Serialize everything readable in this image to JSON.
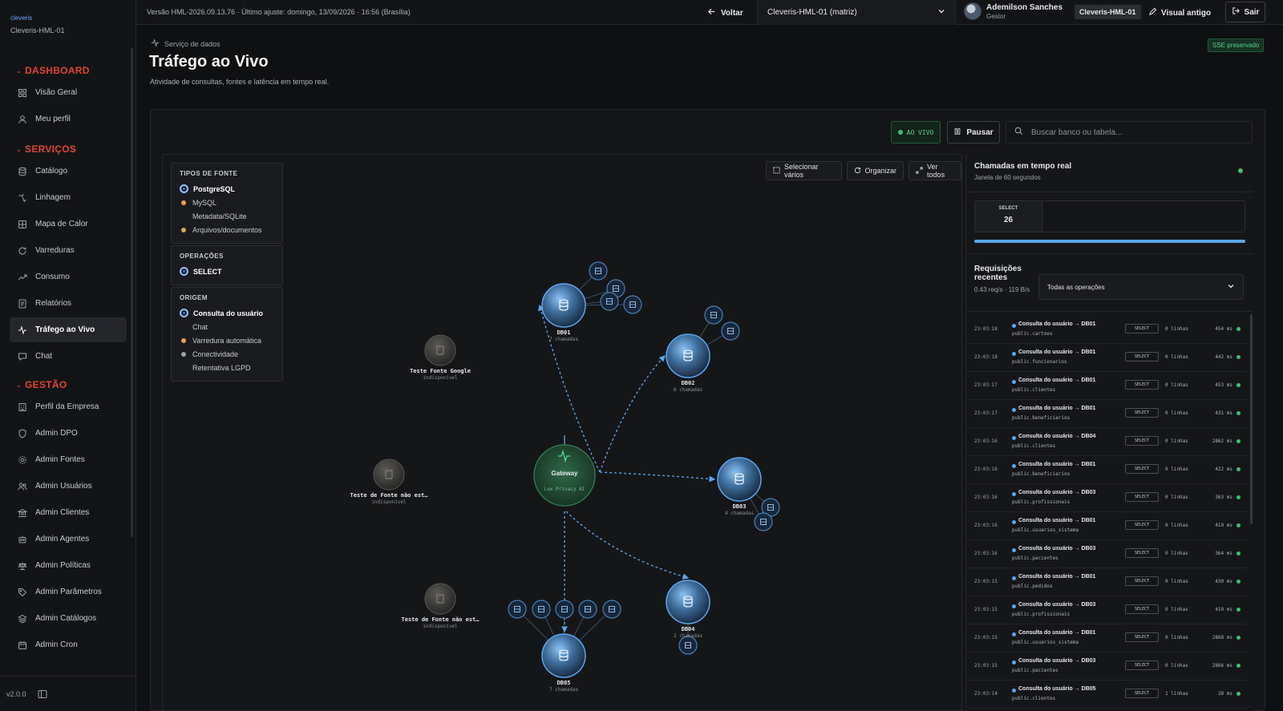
{
  "brand": {
    "logo": "cleveris",
    "env": "Cleveris-HML-01"
  },
  "sidebar": {
    "sections": [
      {
        "title": "DASHBOARD",
        "items": [
          {
            "label": "Visão Geral",
            "icon": "grid-icon"
          },
          {
            "label": "Meu perfil",
            "icon": "user-icon"
          }
        ]
      },
      {
        "title": "SERVIÇOS",
        "items": [
          {
            "label": "Catálogo",
            "icon": "database-icon"
          },
          {
            "label": "Linhagem",
            "icon": "lineage-icon"
          },
          {
            "label": "Mapa de Calor",
            "icon": "heatmap-icon"
          },
          {
            "label": "Varreduras",
            "icon": "refresh-icon"
          },
          {
            "label": "Consumo",
            "icon": "trend-icon"
          },
          {
            "label": "Relatórios",
            "icon": "report-icon"
          },
          {
            "label": "Tráfego ao Vivo",
            "icon": "activity-icon",
            "active": true
          },
          {
            "label": "Chat",
            "icon": "chat-icon"
          }
        ]
      },
      {
        "title": "GESTÃO",
        "items": [
          {
            "label": "Perfil da Empresa",
            "icon": "building-icon"
          },
          {
            "label": "Admin DPO",
            "icon": "shield-icon"
          },
          {
            "label": "Admin Fontes",
            "icon": "gear-icon"
          },
          {
            "label": "Admin Usuários",
            "icon": "users-icon"
          },
          {
            "label": "Admin Clientes",
            "icon": "bank-icon"
          },
          {
            "label": "Admin Agentes",
            "icon": "robot-icon"
          },
          {
            "label": "Admin Políticas",
            "icon": "scale-icon"
          },
          {
            "label": "Admin Parâmetros",
            "icon": "tag-icon"
          },
          {
            "label": "Admin Catálogos",
            "icon": "layers-icon"
          },
          {
            "label": "Admin Cron",
            "icon": "calendar-icon"
          }
        ]
      }
    ],
    "version": "v2.0.0"
  },
  "topbar": {
    "info": "Versão HML-2026.09.13.76 · Último ajuste: domingo, 13/09/2026 · 16:56 (Brasília)",
    "back_label": "Voltar",
    "env_select": "Cleveris-HML-01 (matriz)",
    "user_name": "Ademilson Sanches",
    "user_role": "Gestor",
    "env_badge": "Cleveris-HML-01",
    "visual_label": "Visual antigo",
    "exit_label": "Sair"
  },
  "header": {
    "crumb": "Serviço de dados",
    "title": "Tráfego ao Vivo",
    "subtitle": "Atividade de consultas, fontes e latência em tempo real.",
    "sse_badge": "SSE preservado"
  },
  "controls": {
    "live_label": "AO VIVO",
    "pause_label": "Pausar",
    "search_placeholder": "Buscar banco ou tabela..."
  },
  "graph_toolbar": {
    "select_label": "Selecionar vários",
    "organize_label": "Organizar",
    "view_all_label": "Ver todos"
  },
  "filters": {
    "source_types": {
      "title": "TIPOS DE FONTE",
      "items": [
        {
          "label": "PostgreSQL",
          "selected": true,
          "color": ""
        },
        {
          "label": "MySQL",
          "selected": false,
          "color": "#e8a24a"
        },
        {
          "label": "Metadata/SQLite",
          "selected": false,
          "color": ""
        },
        {
          "label": "Arquivos/documentos",
          "selected": false,
          "color": "#e8a24a"
        }
      ]
    },
    "operations": {
      "title": "OPERAÇÕES",
      "items": [
        {
          "label": "SELECT",
          "selected": true,
          "color": ""
        }
      ]
    },
    "origin": {
      "title": "ORIGEM",
      "items": [
        {
          "label": "Consulta do usuário",
          "selected": true,
          "color": ""
        },
        {
          "label": "Chat",
          "selected": false,
          "color": ""
        },
        {
          "label": "Varredura automática",
          "selected": false,
          "color": "#e8a24a"
        },
        {
          "label": "Conectividade",
          "selected": false,
          "color": "#9aa0a8"
        },
        {
          "label": "Retentativa LGPD",
          "selected": false,
          "color": ""
        }
      ]
    }
  },
  "graph": {
    "gateway": {
      "name": "Gateway",
      "sub": "Lex-Privacy AI"
    },
    "databases": [
      {
        "name": "DB01",
        "sub": "7 chamadas"
      },
      {
        "name": "DB02",
        "sub": "6 chamadas"
      },
      {
        "name": "DB03",
        "sub": "4 chamadas"
      },
      {
        "name": "DB04",
        "sub": "2 chamadas"
      },
      {
        "name": "DB05",
        "sub": "7 chamadas"
      }
    ],
    "offline": [
      {
        "name": "Teste Fonte Google",
        "sub": "indisponível"
      },
      {
        "name": "Teste de Fonte não est…",
        "sub": "indisponível"
      },
      {
        "name": "Teste de Fonte não est…",
        "sub": "indisponível"
      }
    ]
  },
  "realtime": {
    "title": "Chamadas em tempo real",
    "subtitle": "Janela de 60 segundos",
    "stat_label": "SELECT",
    "stat_value": "26",
    "stat_fraction": 1.0,
    "requests_title": "Requisições recentes",
    "rate": "0.43 req/s · 119 B/s",
    "op_filter": "Todas as operações"
  },
  "requests": [
    {
      "time": "23:03:18",
      "label": "Consulta do usuário → DB01",
      "table": "public.cartoes",
      "op": "SELECT",
      "rows": "0 linhas",
      "ms": "454 ms"
    },
    {
      "time": "23:03:18",
      "label": "Consulta do usuário → DB01",
      "table": "public.funcionarios",
      "op": "SELECT",
      "rows": "0 linhas",
      "ms": "442 ms"
    },
    {
      "time": "23:03:17",
      "label": "Consulta do usuário → DB01",
      "table": "public.clientes",
      "op": "SELECT",
      "rows": "0 linhas",
      "ms": "453 ms"
    },
    {
      "time": "23:03:17",
      "label": "Consulta do usuário → DB01",
      "table": "public.beneficiarios",
      "op": "SELECT",
      "rows": "0 linhas",
      "ms": "431 ms"
    },
    {
      "time": "23:03:16",
      "label": "Consulta do usuário → DB04",
      "table": "public.clientes",
      "op": "SELECT",
      "rows": "0 linhas",
      "ms": "2862 ms"
    },
    {
      "time": "23:03:16",
      "label": "Consulta do usuário → DB01",
      "table": "public.beneficiarios",
      "op": "SELECT",
      "rows": "0 linhas",
      "ms": "422 ms"
    },
    {
      "time": "23:03:16",
      "label": "Consulta do usuário → DB03",
      "table": "public.profissionais",
      "op": "SELECT",
      "rows": "0 linhas",
      "ms": "363 ms"
    },
    {
      "time": "23:03:16",
      "label": "Consulta do usuário → DB01",
      "table": "public.usuarios_sistema",
      "op": "SELECT",
      "rows": "0 linhas",
      "ms": "419 ms"
    },
    {
      "time": "23:03:16",
      "label": "Consulta do usuário → DB03",
      "table": "public.pacientes",
      "op": "SELECT",
      "rows": "0 linhas",
      "ms": "364 ms"
    },
    {
      "time": "23:03:15",
      "label": "Consulta do usuário → DB01",
      "table": "public.pedidos",
      "op": "SELECT",
      "rows": "0 linhas",
      "ms": "430 ms"
    },
    {
      "time": "23:03:15",
      "label": "Consulta do usuário → DB03",
      "table": "public.profissionais",
      "op": "SELECT",
      "rows": "0 linhas",
      "ms": "419 ms"
    },
    {
      "time": "23:03:15",
      "label": "Consulta do usuário → DB01",
      "table": "public.usuarios_sistema",
      "op": "SELECT",
      "rows": "0 linhas",
      "ms": "2868 ms"
    },
    {
      "time": "23:03:15",
      "label": "Consulta do usuário → DB03",
      "table": "public.pacientes",
      "op": "SELECT",
      "rows": "0 linhas",
      "ms": "2866 ms"
    },
    {
      "time": "23:03:14",
      "label": "Consulta do usuário → DB05",
      "table": "public.clientes",
      "op": "SELECT",
      "rows": "1 linhas",
      "ms": "28 ms"
    }
  ]
}
